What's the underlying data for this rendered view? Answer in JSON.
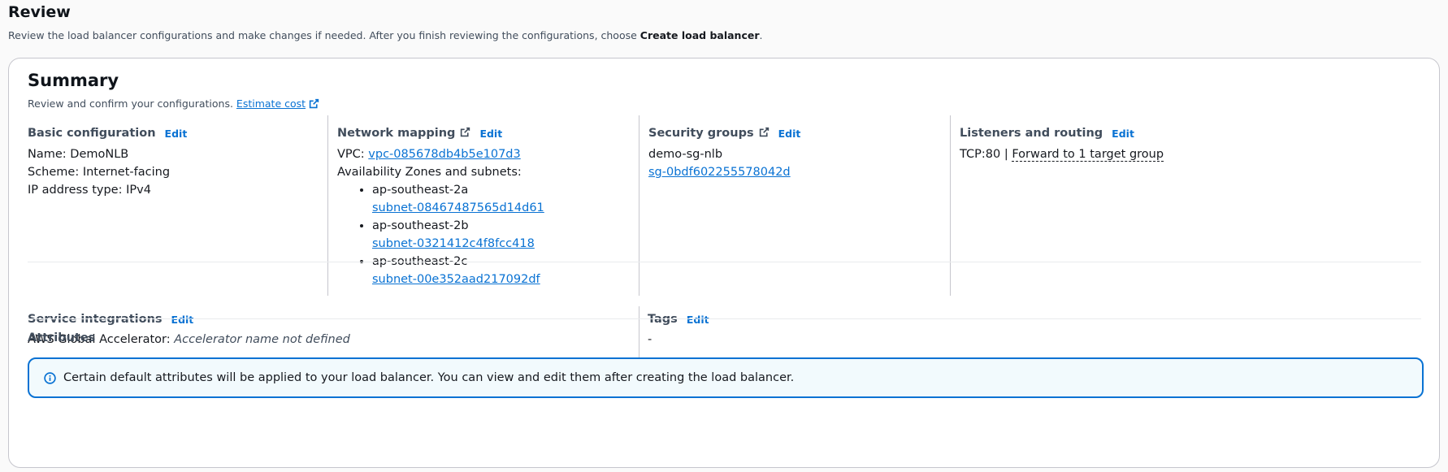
{
  "page": {
    "title": "Review",
    "description_prefix": "Review the load balancer configurations and make changes if needed. After you finish reviewing the configurations, choose ",
    "description_bold": "Create load balancer",
    "description_suffix": "."
  },
  "summary": {
    "title": "Summary",
    "description": "Review and confirm your configurations.",
    "estimate_cost_label": "Estimate cost"
  },
  "basic_configuration": {
    "title": "Basic configuration",
    "edit_label": "Edit",
    "name": "Name: DemoNLB",
    "scheme": "Scheme: Internet-facing",
    "ip_address_type": "IP address type: IPv4"
  },
  "network_mapping": {
    "title": "Network mapping",
    "edit_label": "Edit",
    "vpc_label": "VPC:",
    "vpc_id": "vpc-085678db4b5e107d3",
    "az_label": "Availability Zones and subnets:",
    "zones": [
      {
        "zone": "ap-southeast-2a",
        "subnet": "subnet-08467487565d14d61"
      },
      {
        "zone": "ap-southeast-2b",
        "subnet": "subnet-0321412c4f8fcc418"
      },
      {
        "zone": "ap-southeast-2c",
        "subnet": "subnet-00e352aad217092df"
      }
    ]
  },
  "security_groups": {
    "title": "Security groups",
    "edit_label": "Edit",
    "name": "demo-sg-nlb",
    "id": "sg-0bdf602255578042d"
  },
  "listeners": {
    "title": "Listeners and routing",
    "edit_label": "Edit",
    "listener": "TCP:80 |",
    "forward_label": "Forward to 1 target group"
  },
  "service_integrations": {
    "title": "Service integrations",
    "edit_label": "Edit",
    "label": "AWS Global Accelerator:",
    "value": "Accelerator name not defined"
  },
  "tags": {
    "title": "Tags",
    "edit_label": "Edit",
    "value": "-"
  },
  "attributes": {
    "title": "Attributes",
    "alert_text": "Certain default attributes will be applied to your load balancer. You can view and edit them after creating the load balancer."
  },
  "colors": {
    "link": "#0972d3",
    "info_border": "#0972d3",
    "info_background": "#f2fafd"
  }
}
